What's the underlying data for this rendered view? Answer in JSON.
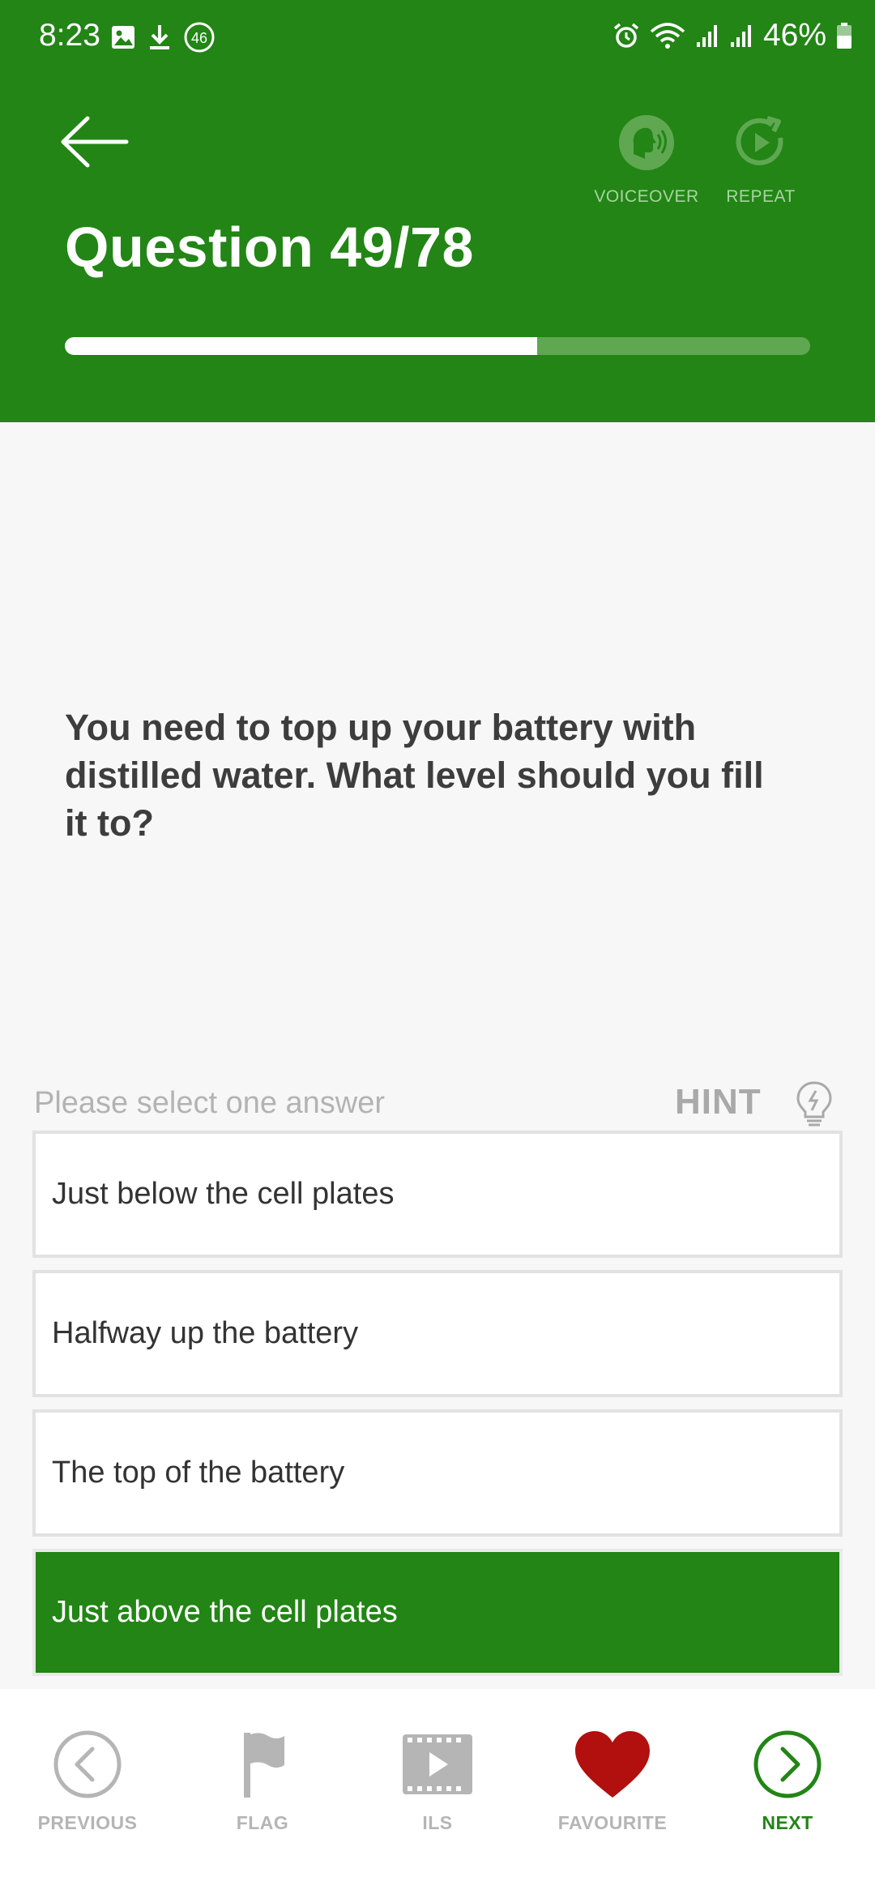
{
  "status_bar": {
    "time": "8:23",
    "notification_badge": "46",
    "battery_percent": "46%",
    "icons_left": [
      "image-icon",
      "download-icon",
      "badge-46-icon"
    ],
    "icons_right": [
      "alarm-icon",
      "wifi-icon",
      "signal-icon",
      "signal-icon",
      "battery-icon"
    ]
  },
  "header": {
    "background_color": "#228515",
    "back_icon": "arrow-left-icon",
    "voiceover_label": "VOICEOVER",
    "repeat_label": "REPEAT",
    "question_title": "Question 49/78",
    "progress": {
      "current": 49,
      "total": 78,
      "fraction": 0.634
    }
  },
  "question": {
    "text": "You need to top up your battery with distilled water. What level should you fill it to?"
  },
  "answers_section": {
    "prompt": "Please select one answer",
    "hint_label": "HINT",
    "options": [
      {
        "text": "Just below the cell plates",
        "selected": false
      },
      {
        "text": "Halfway up the battery",
        "selected": false
      },
      {
        "text": "The top of the battery",
        "selected": false
      },
      {
        "text": "Just above the cell plates",
        "selected": true
      }
    ]
  },
  "bottom_nav": {
    "previous": "PREVIOUS",
    "flag": "FLAG",
    "ils": "ILS",
    "favourite": "FAVOURITE",
    "next": "NEXT",
    "accent_color": "#228515",
    "favourite_color": "#b20f0f"
  }
}
